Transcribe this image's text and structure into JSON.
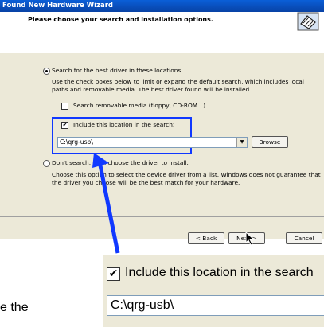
{
  "window": {
    "title": "Found New Hardware Wizard"
  },
  "header": {
    "title": "Please choose your search and installation options."
  },
  "options": {
    "search_radio_label": "Search for the best driver in these locations.",
    "search_desc_line1": "Use the check boxes below to limit or expand the default search, which includes local",
    "search_desc_line2": "paths and removable media. The best driver found will be installed.",
    "removable_label": "Search removable media (floppy, CD-ROM...)",
    "removable_checked": false,
    "include_label": "Include this location in the search:",
    "include_checked": true,
    "path_value": "C:\\qrg-usb\\",
    "browse_label": "Browse",
    "dont_search_label": "Don't search. I will choose the driver to install.",
    "dont_desc_line1": "Choose this option to select the device driver from a list.  Windows does not guarantee that",
    "dont_desc_line2": "the driver you choose will be the best match for your hardware."
  },
  "buttons": {
    "back": "< Back",
    "next": "Next >",
    "cancel": "Cancel"
  },
  "zoom": {
    "include_label": "Include this location in the search",
    "path_value": "C:\\qrg-usb\\"
  },
  "stray_text": "e the",
  "colors": {
    "annotation": "#1038ff",
    "titlebar": "#0a5fd8"
  },
  "icons": [
    "hardware-wizard-icon",
    "check-icon",
    "dropdown-arrow-icon",
    "mouse-cursor-icon",
    "callout-arrow"
  ]
}
